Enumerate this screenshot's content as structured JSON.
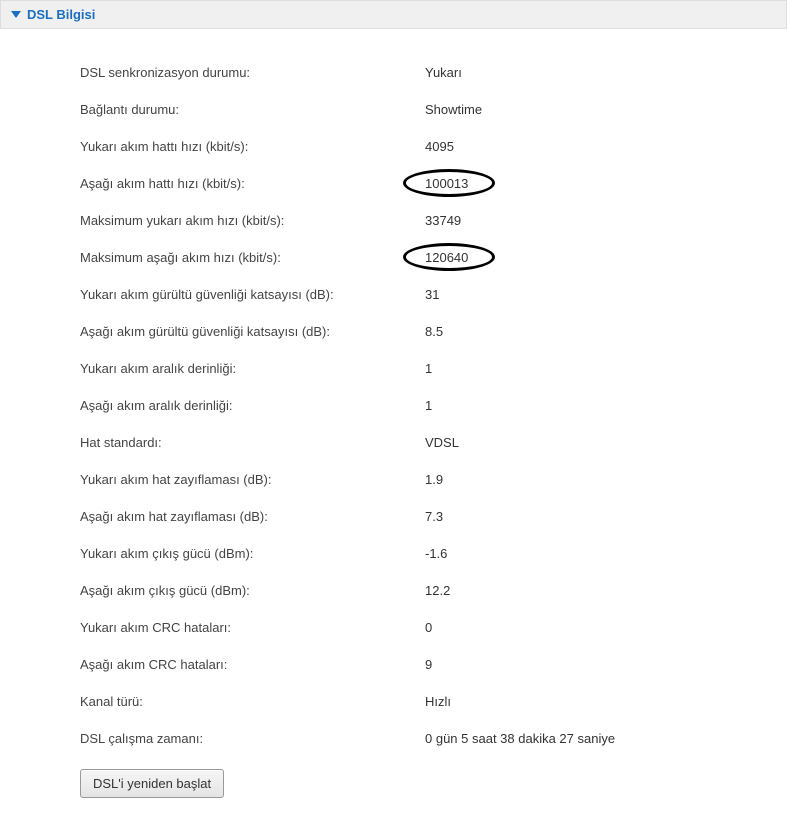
{
  "panel": {
    "title": "DSL Bilgisi"
  },
  "rows": [
    {
      "label": "DSL senkronizasyon durumu:",
      "value": "Yukarı"
    },
    {
      "label": "Bağlantı durumu:",
      "value": "Showtime"
    },
    {
      "label": "Yukarı akım hattı hızı (kbit/s):",
      "value": "4095"
    },
    {
      "label": "Aşağı akım hattı hızı (kbit/s):",
      "value": "100013"
    },
    {
      "label": "Maksimum yukarı akım hızı (kbit/s):",
      "value": "33749"
    },
    {
      "label": "Maksimum aşağı akım hızı (kbit/s):",
      "value": "120640"
    },
    {
      "label": "Yukarı akım gürültü güvenliği katsayısı (dB):",
      "value": "31"
    },
    {
      "label": "Aşağı akım gürültü güvenliği katsayısı (dB):",
      "value": "8.5"
    },
    {
      "label": "Yukarı akım aralık derinliği:",
      "value": "1"
    },
    {
      "label": "Aşağı akım aralık derinliği:",
      "value": "1"
    },
    {
      "label": "Hat standardı:",
      "value": "VDSL"
    },
    {
      "label": "Yukarı akım hat zayıflaması (dB):",
      "value": "1.9"
    },
    {
      "label": "Aşağı akım hat zayıflaması (dB):",
      "value": "7.3"
    },
    {
      "label": "Yukarı akım çıkış gücü (dBm):",
      "value": "-1.6"
    },
    {
      "label": "Aşağı akım çıkış gücü (dBm):",
      "value": "12.2"
    },
    {
      "label": "Yukarı akım CRC hataları:",
      "value": "0"
    },
    {
      "label": "Aşağı akım CRC hataları:",
      "value": "9"
    },
    {
      "label": "Kanal türü:",
      "value": "Hızlı"
    },
    {
      "label": "DSL çalışma zamanı:",
      "value": "0 gün 5 saat 38 dakika 27 saniye"
    }
  ],
  "button": {
    "restart_label": "DSL'i yeniden başlat"
  },
  "annotations": {
    "circled_row_indices": [
      3,
      5
    ]
  }
}
